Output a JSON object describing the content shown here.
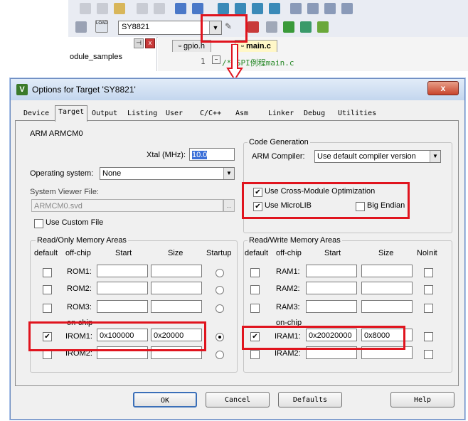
{
  "ide": {
    "target_name": "SY8821",
    "project_item": "odule_samples",
    "file_tabs": [
      "gpio.h",
      "main.c"
    ],
    "editor_line": "1",
    "editor_text": "/* SPI例程main.c"
  },
  "dialog": {
    "title": "Options for Target 'SY8821'",
    "close_label": "x",
    "tabs": [
      "Device",
      "Target",
      "Output",
      "Listing",
      "User",
      "C/C++",
      "Asm",
      "Linker",
      "Debug",
      "Utilities"
    ],
    "active_tab": "Target",
    "device_name": "ARM ARMCM0",
    "xtal_label": "Xtal (MHz):",
    "xtal_value": "10.0",
    "os_label": "Operating system:",
    "os_value": "None",
    "svd_label": "System Viewer File:",
    "svd_value": "ARMCM0.svd",
    "svd_browse": "...",
    "custom_file_label": "Use Custom File",
    "codegen": {
      "title": "Code Generation",
      "compiler_label": "ARM Compiler:",
      "compiler_value": "Use default compiler version",
      "cross_module_label": "Use Cross-Module Optimization",
      "microlib_label": "Use MicroLIB",
      "big_endian_label": "Big Endian"
    },
    "rom": {
      "title": "Read/Only Memory Areas",
      "headers": {
        "default": "default",
        "offchip": "off-chip",
        "start": "Start",
        "size": "Size",
        "startup": "Startup"
      },
      "onchip_label": "on-chip",
      "rows": [
        {
          "label": "ROM1:",
          "start": "",
          "size": ""
        },
        {
          "label": "ROM2:",
          "start": "",
          "size": ""
        },
        {
          "label": "ROM3:",
          "start": "",
          "size": ""
        },
        {
          "label": "IROM1:",
          "start": "0x100000",
          "size": "0x20000"
        },
        {
          "label": "IROM2:",
          "start": "",
          "size": ""
        }
      ]
    },
    "ram": {
      "title": "Read/Write Memory Areas",
      "headers": {
        "default": "default",
        "offchip": "off-chip",
        "start": "Start",
        "size": "Size",
        "noinit": "NoInit"
      },
      "onchip_label": "on-chip",
      "rows": [
        {
          "label": "RAM1:",
          "start": "",
          "size": ""
        },
        {
          "label": "RAM2:",
          "start": "",
          "size": ""
        },
        {
          "label": "RAM3:",
          "start": "",
          "size": ""
        },
        {
          "label": "IRAM1:",
          "start": "0x20020000",
          "size": "0x8000"
        },
        {
          "label": "IRAM2:",
          "start": "",
          "size": ""
        }
      ]
    },
    "buttons": {
      "ok": "OK",
      "cancel": "Cancel",
      "defaults": "Defaults",
      "help": "Help"
    }
  },
  "colors": {
    "highlight_red": "#e0141e",
    "titlebar": "#c3d6ee",
    "dialog_bg": "#f0f0f0"
  }
}
